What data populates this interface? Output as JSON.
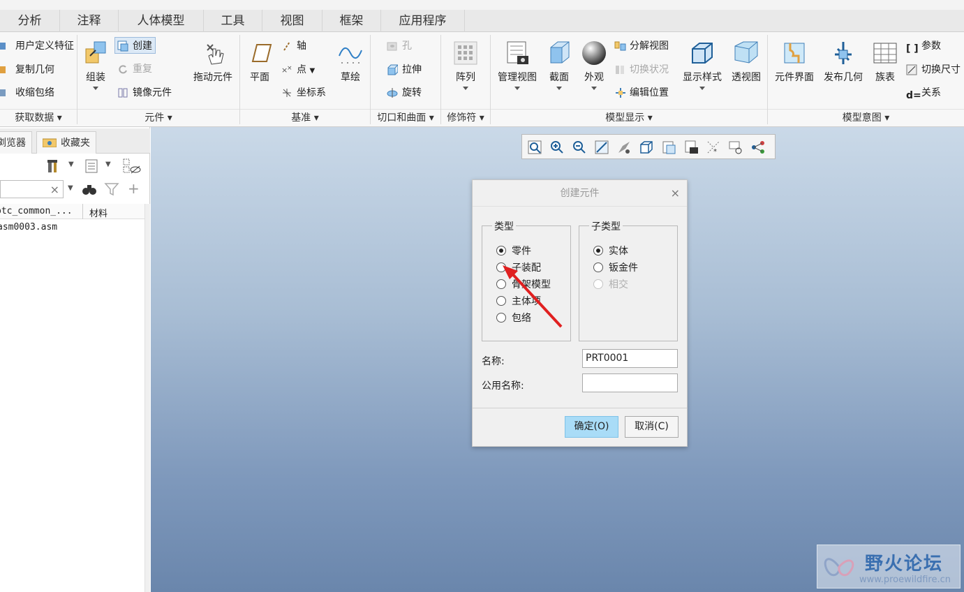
{
  "tabs": [
    "分析",
    "注释",
    "人体模型",
    "工具",
    "视图",
    "框架",
    "应用程序"
  ],
  "ribbon": {
    "get_data": {
      "items": [
        "用户定义特征",
        "复制几何",
        "收缩包络"
      ],
      "label": "获取数据"
    },
    "component": {
      "assemble": "组装",
      "create": "创建",
      "repeat": "重复",
      "mirror": "镜像元件",
      "drag": "拖动元件",
      "label": "元件"
    },
    "datum": {
      "plane": "平面",
      "axis": "轴",
      "point": "点",
      "csys": "坐标系",
      "sketch": "草绘",
      "label": "基准"
    },
    "cuts": {
      "hole": "孔",
      "extrude": "拉伸",
      "revolve": "旋转",
      "label": "切口和曲面"
    },
    "modifiers": {
      "pattern": "阵列",
      "label": "修饰符"
    },
    "model_display": {
      "manage_views": "管理视图",
      "section": "截面",
      "appearance": "外观",
      "explode": "分解视图",
      "toggle_status": "切换状况",
      "edit_position": "编辑位置",
      "display_style": "显示样式",
      "perspective": "透视图",
      "label": "模型显示"
    },
    "model_intent": {
      "component_interface": "元件界面",
      "publish_geometry": "发布几何",
      "family_table": "族表",
      "parameters": "参数",
      "switch_dims": "切换尺寸",
      "relations": "关系",
      "label": "模型意图"
    }
  },
  "left_panel": {
    "tabs": [
      "浏览器",
      "收藏夹"
    ],
    "search": {
      "value": "",
      "clear": "×"
    },
    "columns": [
      "ptc_common_...",
      "材料"
    ],
    "rows": [
      "asm0003.asm"
    ]
  },
  "dialog": {
    "title": "创建元件",
    "close": "×",
    "type": {
      "legend": "类型",
      "options": [
        "零件",
        "子装配",
        "骨架模型",
        "主体项",
        "包络"
      ],
      "selected": 0
    },
    "subtype": {
      "legend": "子类型",
      "options": [
        "实体",
        "钣金件",
        "相交"
      ],
      "selected": 0,
      "disabled": [
        2
      ]
    },
    "name_label": "名称:",
    "name_value": "PRT0001",
    "common_name_label": "公用名称:",
    "common_name_value": "",
    "ok": "确定(O)",
    "cancel": "取消(C)"
  },
  "watermark": {
    "title": "野火论坛",
    "url": "www.proewildfire.cn"
  }
}
